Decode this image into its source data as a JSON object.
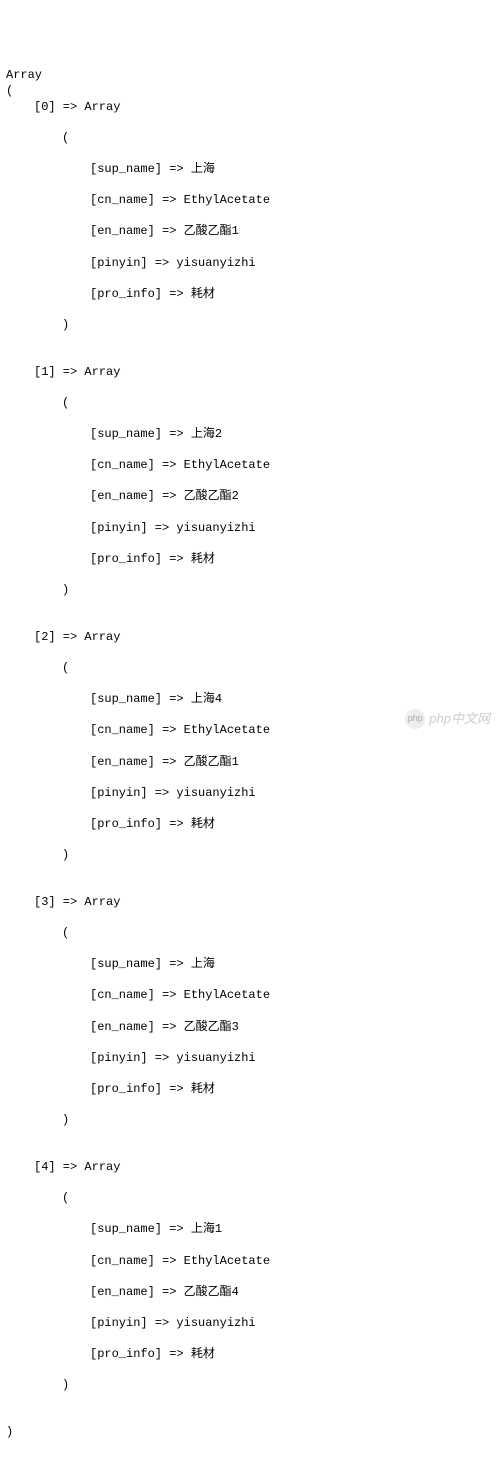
{
  "header": "Array",
  "open_paren": "(",
  "close_paren": ")",
  "arrow": " => ",
  "array_label": "Array",
  "items": [
    {
      "index": "[0]",
      "fields": {
        "sup_name": "上海",
        "cn_name": "EthylAcetate",
        "en_name": "乙酸乙酯1",
        "pinyin": "yisuanyizhi",
        "pro_info": "耗材"
      }
    },
    {
      "index": "[1]",
      "fields": {
        "sup_name": "上海2",
        "cn_name": "EthylAcetate",
        "en_name": "乙酸乙酯2",
        "pinyin": "yisuanyizhi",
        "pro_info": "耗材"
      }
    },
    {
      "index": "[2]",
      "fields": {
        "sup_name": "上海4",
        "cn_name": "EthylAcetate",
        "en_name": "乙酸乙酯1",
        "pinyin": "yisuanyizhi",
        "pro_info": "耗材"
      }
    },
    {
      "index": "[3]",
      "fields": {
        "sup_name": "上海",
        "cn_name": "EthylAcetate",
        "en_name": "乙酸乙酯3",
        "pinyin": "yisuanyizhi",
        "pro_info": "耗材"
      }
    },
    {
      "index": "[4]",
      "fields": {
        "sup_name": "上海1",
        "cn_name": "EthylAcetate",
        "en_name": "乙酸乙酯4",
        "pinyin": "yisuanyizhi",
        "pro_info": "耗材"
      }
    }
  ],
  "field_keys": [
    "sup_name",
    "cn_name",
    "en_name",
    "pinyin",
    "pro_info"
  ],
  "watermark": "php中文网"
}
